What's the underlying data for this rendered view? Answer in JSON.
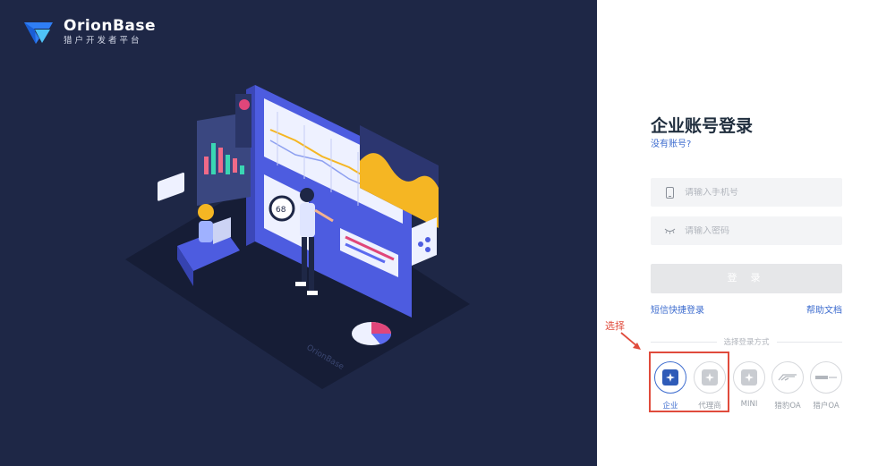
{
  "brand": {
    "name": "OrionBase",
    "subtitle": "猎户开发者平台",
    "illustration_watermark": "OrionBase"
  },
  "illustration": {
    "dial_value": "68"
  },
  "login": {
    "title": "企业账号登录",
    "no_account": "没有账号?",
    "phone_placeholder": "请输入手机号",
    "password_placeholder": "请输入密码",
    "submit_label": "登 录",
    "sms_login": "短信快捷登录",
    "help_docs": "帮助文档",
    "divider_text": "选择登录方式"
  },
  "methods": [
    {
      "label": "企业",
      "active": true
    },
    {
      "label": "代理商",
      "active": false
    },
    {
      "label": "MINI",
      "active": false
    },
    {
      "label": "猎豹OA",
      "active": false
    },
    {
      "label": "猎户OA",
      "active": false
    }
  ],
  "annotation": {
    "text": "选择",
    "color": "#e04b3c"
  },
  "colors": {
    "left_bg": "#1e2746",
    "accent": "#3d6ccf",
    "button_disabled": "#e6e7e9"
  }
}
